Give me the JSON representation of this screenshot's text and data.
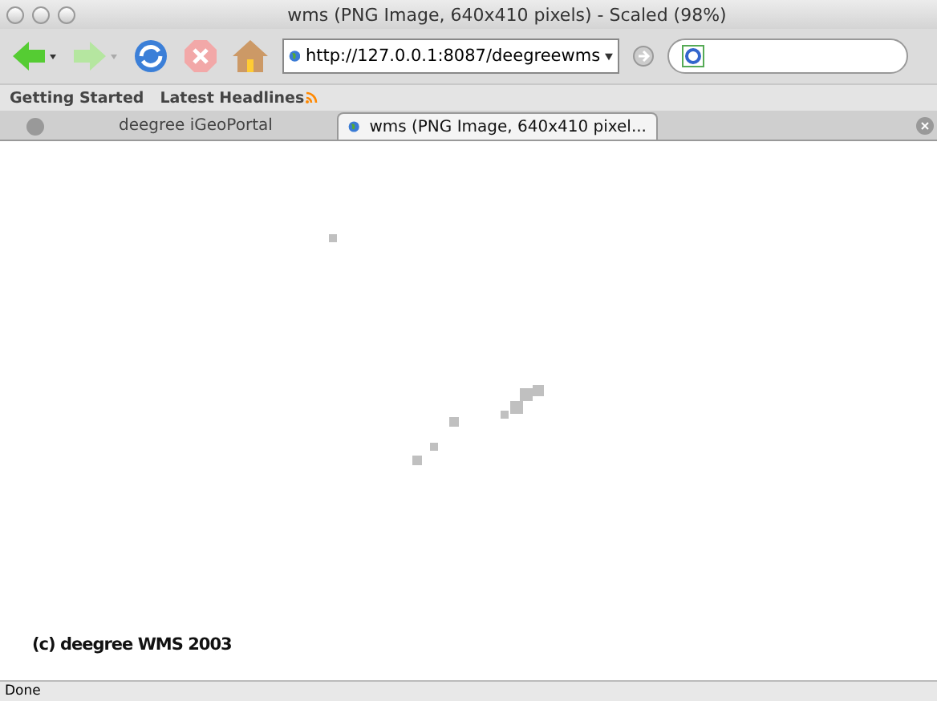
{
  "window": {
    "title": "wms (PNG Image, 640x410 pixels) - Scaled (98%)"
  },
  "toolbar": {
    "url": "http://127.0.0.1:8087/deegreewms"
  },
  "bookmarks": [
    "Getting Started",
    "Latest Headlines"
  ],
  "tabs": [
    {
      "label": "deegree iGeoPortal",
      "selected": false
    },
    {
      "label": "wms (PNG Image, 640x410 pixel...",
      "selected": true
    }
  ],
  "image": {
    "copyright": "(c) deegree WMS 2003"
  },
  "status_bar": "Done"
}
